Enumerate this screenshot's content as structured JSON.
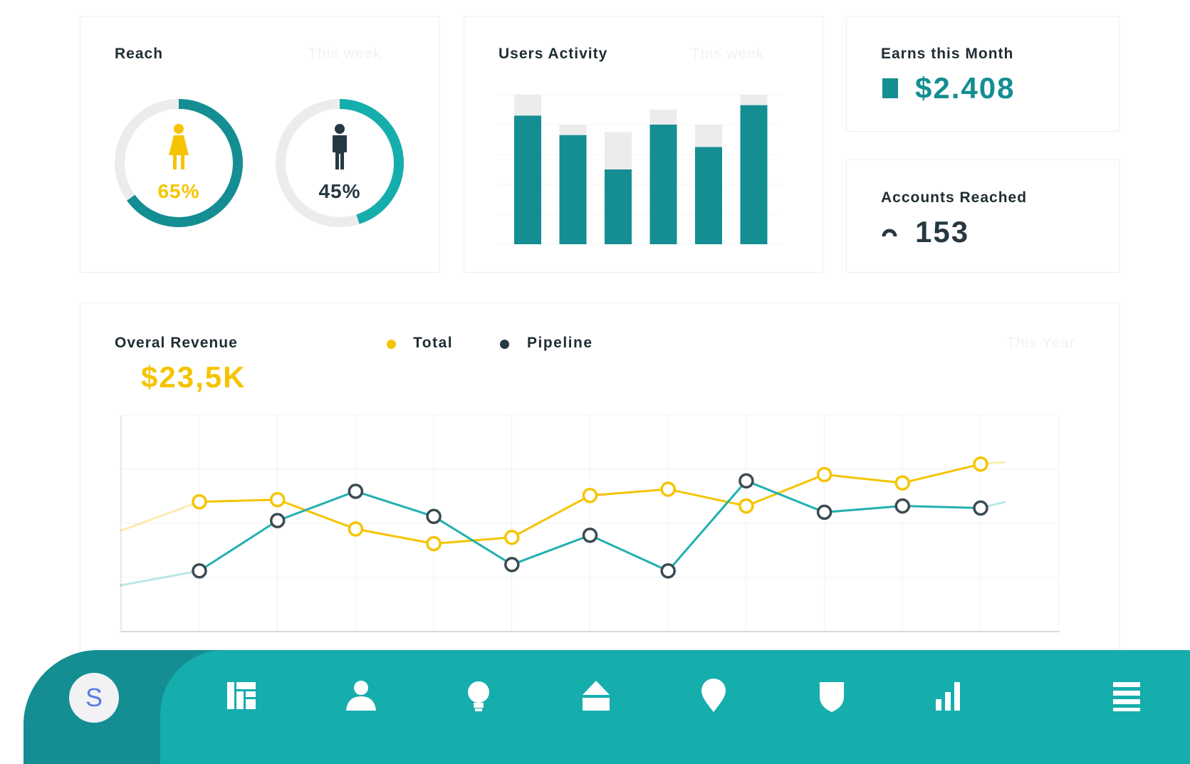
{
  "reach": {
    "title": "Reach",
    "period": "This week",
    "female": {
      "percent": 65,
      "label": "65%",
      "color": "#f5c400",
      "ring_color": "#148e93"
    },
    "male": {
      "percent": 45,
      "label": "45%",
      "color": "#263842",
      "ring_color": "#16adad"
    }
  },
  "users_activity": {
    "title": "Users Activity",
    "period": "This week"
  },
  "earns": {
    "title": "Earns this Month",
    "value": "$2.408",
    "icon": "wallet-icon"
  },
  "accounts": {
    "title": "Accounts Reached",
    "value": "153",
    "icon": "arc-icon"
  },
  "revenue": {
    "title": "Overal Revenue",
    "value": "$23,5K",
    "period": "This Year",
    "legend": [
      {
        "label": "Total",
        "color": "#f5c400"
      },
      {
        "label": "Pipeline",
        "color": "#263842"
      }
    ]
  },
  "navbar": {
    "avatar_letter": "S",
    "icons": [
      "dashboard-icon",
      "user-icon",
      "lightbulb-icon",
      "home-icon",
      "location-pin-icon",
      "shield-icon",
      "bar-chart-icon",
      "menu-icon"
    ]
  },
  "colors": {
    "teal_dark": "#148e93",
    "teal": "#16adad",
    "yellow": "#f5c400",
    "navy": "#263842",
    "bar_bg": "#ececec"
  },
  "chart_data": [
    {
      "type": "bar",
      "name": "users-activity",
      "categories": [
        "",
        "",
        "",
        "",
        "",
        ""
      ],
      "values": [
        86,
        73,
        50,
        80,
        65,
        93
      ],
      "capacity": [
        100,
        80,
        75,
        90,
        80,
        100
      ],
      "ylim": [
        0,
        100
      ]
    },
    {
      "type": "line",
      "name": "overall-revenue",
      "x": [
        1,
        2,
        3,
        4,
        5,
        6,
        7,
        8,
        9,
        10,
        11
      ],
      "series": [
        {
          "name": "Total",
          "values": [
            62,
            63,
            49,
            42,
            45,
            65,
            68,
            60,
            75,
            71,
            80
          ]
        },
        {
          "name": "Pipeline",
          "values": [
            29,
            53,
            67,
            55,
            32,
            46,
            29,
            72,
            57,
            60,
            59
          ]
        }
      ],
      "ylim": [
        0,
        100
      ]
    }
  ]
}
